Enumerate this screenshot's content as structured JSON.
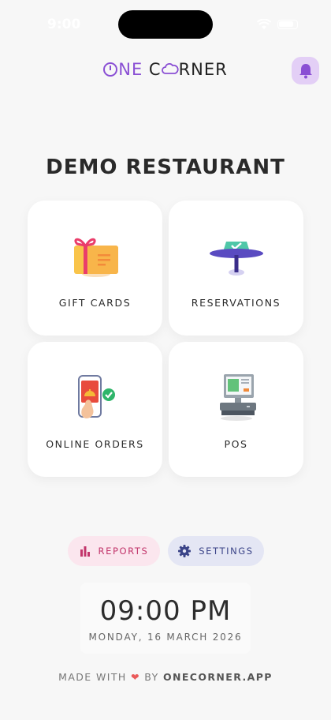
{
  "status_bar": {
    "time": "9:00"
  },
  "header": {
    "logo_part1": "ONE C",
    "logo_part2": "RNER",
    "bell_icon": "bell-icon"
  },
  "page_title": "DEMO RESTAURANT",
  "cards": [
    {
      "label": "GIFT CARDS",
      "icon": "gift-card-icon"
    },
    {
      "label": "RESERVATIONS",
      "icon": "reserved-table-icon"
    },
    {
      "label": "ONLINE ORDERS",
      "icon": "phone-order-icon"
    },
    {
      "label": "POS",
      "icon": "cash-register-icon"
    }
  ],
  "actions": {
    "reports_label": "REPORTS",
    "settings_label": "SETTINGS"
  },
  "clock": {
    "time": "09:00 PM",
    "date": "MONDAY, 16 MARCH 2026"
  },
  "footer": {
    "made_with": "MADE WITH",
    "by": "BY",
    "brand": "ONECORNER.APP"
  },
  "colors": {
    "accent": "#8a4fd4",
    "reports": "#c2356b",
    "settings": "#3b4488"
  }
}
